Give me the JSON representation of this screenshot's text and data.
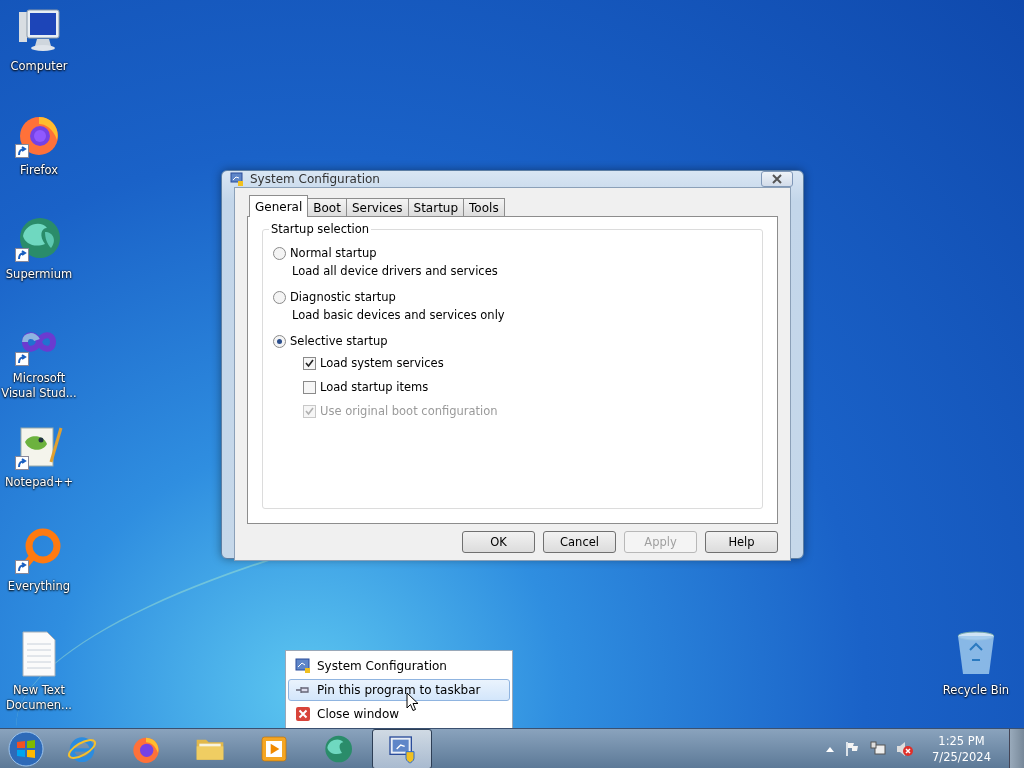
{
  "desktop_icons": [
    {
      "label": "Computer",
      "kind": "computer",
      "shortcut": false
    },
    {
      "label": "Firefox",
      "kind": "firefox",
      "shortcut": true
    },
    {
      "label": "Supermium",
      "kind": "supermium",
      "shortcut": true
    },
    {
      "label": "Microsoft Visual Stud...",
      "kind": "vs",
      "shortcut": true
    },
    {
      "label": "Notepad++",
      "kind": "notepad",
      "shortcut": true
    },
    {
      "label": "Everything",
      "kind": "everything",
      "shortcut": true
    },
    {
      "label": "New Text Documen...",
      "kind": "textfile",
      "shortcut": false
    }
  ],
  "recycle_bin": {
    "label": "Recycle Bin"
  },
  "dialog": {
    "title": "System Configuration",
    "tabs": [
      {
        "label": "General",
        "selected": true
      },
      {
        "label": "Boot",
        "selected": false
      },
      {
        "label": "Services",
        "selected": false
      },
      {
        "label": "Startup",
        "selected": false
      },
      {
        "label": "Tools",
        "selected": false
      }
    ],
    "group_title": "Startup selection",
    "options": [
      {
        "label": "Normal startup",
        "description": "Load all device drivers and services",
        "selected": false
      },
      {
        "label": "Diagnostic startup",
        "description": "Load basic devices and services only",
        "selected": false
      },
      {
        "label": "Selective startup",
        "selected": true
      }
    ],
    "sub_options": [
      {
        "label": "Load system services",
        "checked": true,
        "disabled": false
      },
      {
        "label": "Load startup items",
        "checked": false,
        "disabled": false
      },
      {
        "label": "Use original boot configuration",
        "checked": true,
        "disabled": true
      }
    ],
    "buttons": [
      {
        "label": "OK",
        "disabled": false
      },
      {
        "label": "Cancel",
        "disabled": false
      },
      {
        "label": "Apply",
        "disabled": true
      },
      {
        "label": "Help",
        "disabled": false
      }
    ]
  },
  "jump_list": [
    {
      "label": "System Configuration",
      "kind": "app",
      "selected": false
    },
    {
      "label": "Pin this program to taskbar",
      "kind": "pin",
      "selected": true
    },
    {
      "label": "Close window",
      "kind": "close",
      "selected": false
    }
  ],
  "taskbar": {
    "apps": [
      {
        "kind": "ie",
        "active": false
      },
      {
        "kind": "firefox",
        "active": false
      },
      {
        "kind": "explorer",
        "active": false
      },
      {
        "kind": "media",
        "active": false
      },
      {
        "kind": "supermium",
        "active": false
      },
      {
        "kind": "msconfig",
        "active": true
      }
    ]
  },
  "clock": {
    "time": "1:25 PM",
    "date": "7/25/2024"
  }
}
